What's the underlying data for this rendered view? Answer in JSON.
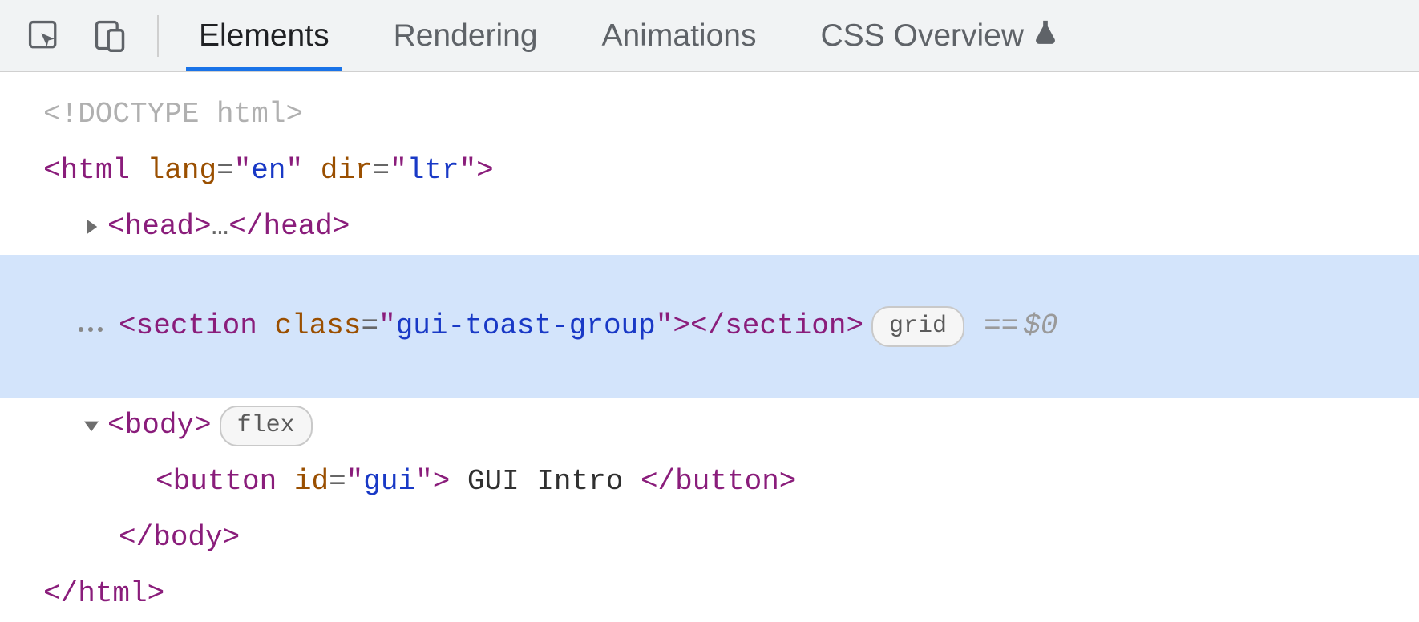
{
  "toolbar": {
    "tabs": {
      "elements": "Elements",
      "rendering": "Rendering",
      "animations": "Animations",
      "css_overview": "CSS Overview"
    }
  },
  "tree": {
    "doctype": "<!DOCTYPE html>",
    "html_open": {
      "tag": "html",
      "attrs": [
        {
          "name": "lang",
          "value": "en"
        },
        {
          "name": "dir",
          "value": "ltr"
        }
      ]
    },
    "head": {
      "tag": "head",
      "collapsed_text": "…"
    },
    "section": {
      "tag": "section",
      "attr_name": "class",
      "attr_value": "gui-toast-group",
      "display_badge": "grid",
      "console_ref": "$0"
    },
    "body": {
      "tag": "body",
      "display_badge": "flex"
    },
    "button": {
      "tag": "button",
      "attr_name": "id",
      "attr_value": "gui",
      "inner_text": " GUI Intro "
    },
    "body_close": "body",
    "html_close": "html"
  }
}
